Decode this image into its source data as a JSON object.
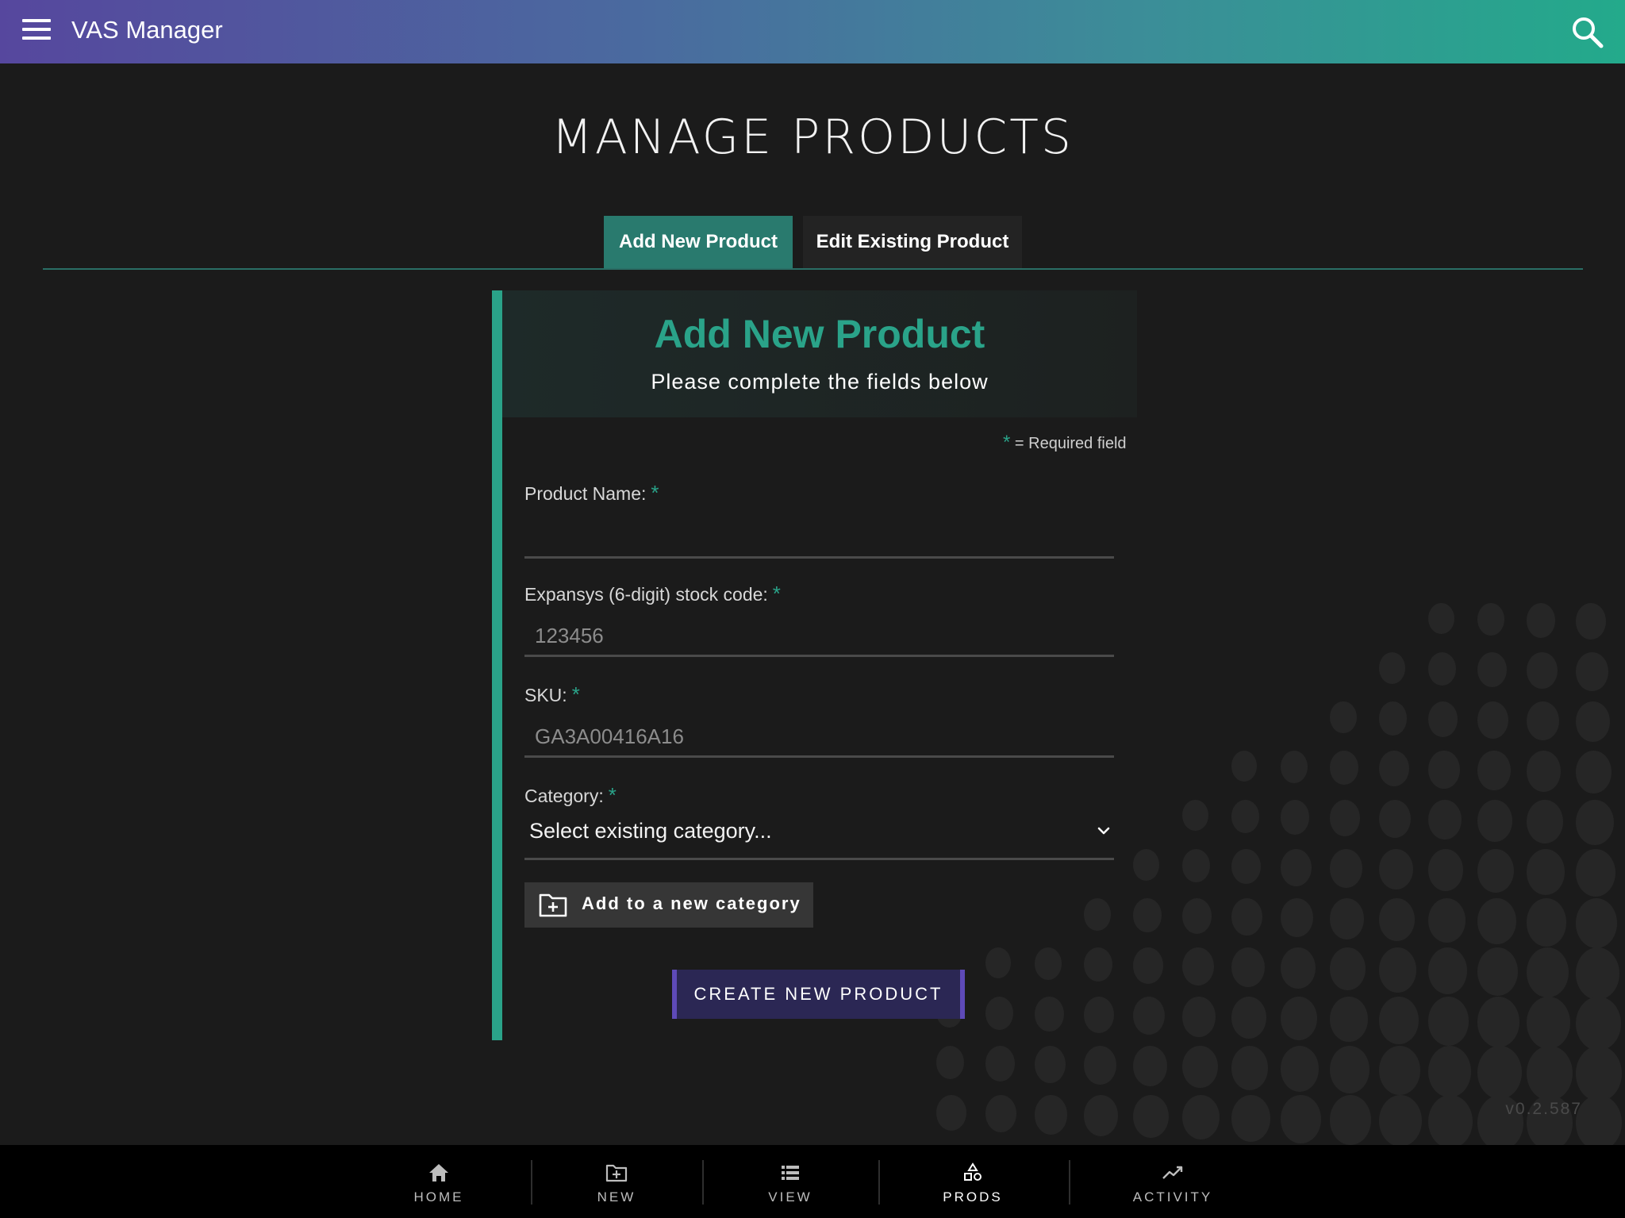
{
  "app": {
    "title": "VAS Manager"
  },
  "page": {
    "title": "MANAGE PRODUCTS"
  },
  "tabs": [
    {
      "label": "Add New Product",
      "active": true
    },
    {
      "label": "Edit Existing Product",
      "active": false
    }
  ],
  "form": {
    "title": "Add New Product",
    "subtitle": "Please complete the fields below",
    "required_note": "= Required field",
    "required_marker": "*",
    "fields": [
      {
        "label": "Product Name:",
        "value": "",
        "placeholder": ""
      },
      {
        "label": "Expansys (6-digit) stock code:",
        "value": "",
        "placeholder": "123456"
      },
      {
        "label": "SKU:",
        "value": "",
        "placeholder": "GA3A00416A16"
      }
    ],
    "category": {
      "label": "Category:",
      "selected": "Select existing category..."
    },
    "add_category_label": "Add to a new category",
    "submit_label": "CREATE NEW PRODUCT"
  },
  "version": "v0.2.587",
  "bottom_nav": [
    {
      "label": "HOME",
      "icon": "home-icon",
      "active": false
    },
    {
      "label": "NEW",
      "icon": "folder-plus-icon",
      "active": false
    },
    {
      "label": "VIEW",
      "icon": "list-icon",
      "active": false
    },
    {
      "label": "PRODS",
      "icon": "shapes-icon",
      "active": true
    },
    {
      "label": "ACTIVITY",
      "icon": "trending-up-icon",
      "active": false
    }
  ],
  "colors": {
    "accent": "#2aa389",
    "header_gradient_start": "#56479e",
    "header_gradient_end": "#23aa8b",
    "submit_border": "#5e4ab8",
    "background": "#1b1b1b"
  }
}
